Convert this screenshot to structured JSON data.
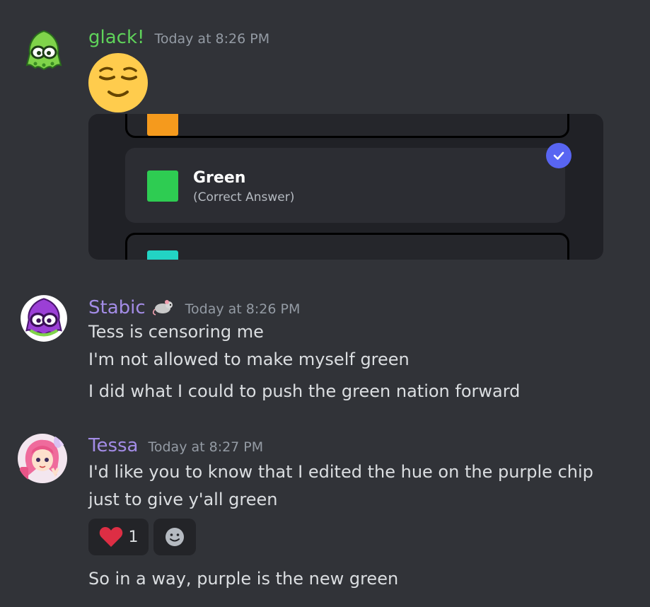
{
  "messages": [
    {
      "username": "glack!",
      "username_color": "#5fd35a",
      "timestamp": "Today at 8:26 PM",
      "avatar_icon": "green-squid-icon",
      "emoji": "relieved-face-emoji",
      "poll": {
        "options": [
          {
            "name": "",
            "subtext": "",
            "swatch_color": "#f59a1d",
            "state": "cut-off-top"
          },
          {
            "name": "Green",
            "subtext": "(Correct Answer)",
            "swatch_color": "#2ecc52",
            "state": "selected"
          },
          {
            "name": "",
            "subtext": "",
            "swatch_color": "#22d4c4",
            "state": "cut-off-bottom"
          }
        ],
        "check_icon": "checkmark-icon",
        "check_color": "#5865f2"
      }
    },
    {
      "username": "Stabic",
      "username_color": "#a38ce6",
      "badge_icon": "mouse-icon",
      "timestamp": "Today at 8:26 PM",
      "avatar_icon": "purple-squid-icon",
      "lines": [
        "Tess is censoring me",
        "I'm not allowed to make myself green",
        "I did what I could to push the green nation forward"
      ]
    },
    {
      "username": "Tessa",
      "username_color": "#a38ce6",
      "timestamp": "Today at 8:27 PM",
      "avatar_icon": "anime-girl-avatar",
      "lines": [
        "I'd like you to know that I edited the hue on the purple chip",
        "just to give y'all green",
        "So in a way, purple is the new green"
      ],
      "reactions": [
        {
          "icon": "heart-icon",
          "count": "1"
        },
        {
          "icon": "add-reaction-icon"
        }
      ]
    }
  ]
}
